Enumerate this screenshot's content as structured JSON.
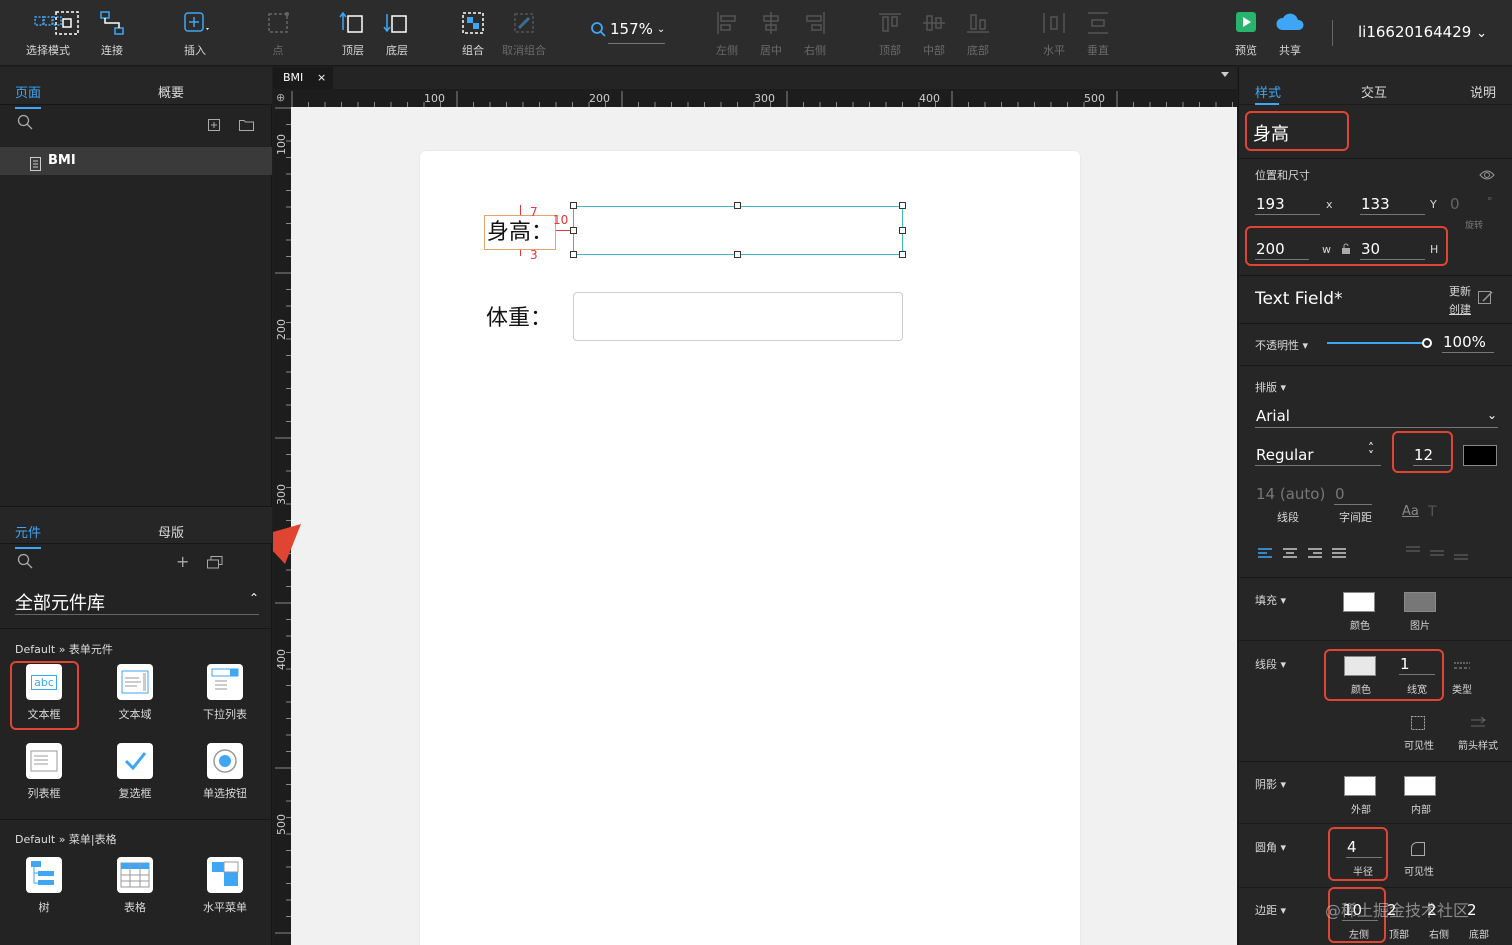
{
  "toolbar": {
    "select_mode": "选择模式",
    "connect": "连接",
    "insert": "插入",
    "point": "点",
    "top_layer": "顶层",
    "bottom_layer": "底层",
    "group": "组合",
    "ungroup": "取消组合",
    "zoom": "157%",
    "align_left": "左侧",
    "align_center": "居中",
    "align_right": "右侧",
    "align_top": "顶部",
    "align_middle": "中部",
    "align_bottom": "底部",
    "dist_h": "水平",
    "dist_v": "垂直",
    "preview": "预览",
    "share": "共享",
    "username": "li16620164429"
  },
  "pages_panel": {
    "tab_pages": "页面",
    "tab_outline": "概要",
    "page_item": "BMI"
  },
  "components_panel": {
    "tab_components": "元件",
    "tab_masters": "母版",
    "library": "全部元件库",
    "group1": "Default » 表单元件",
    "items1": [
      "文本框",
      "文本域",
      "下拉列表",
      "列表框",
      "复选框",
      "单选按钮"
    ],
    "group2": "Default » 菜单|表格",
    "items2": [
      "树",
      "表格",
      "水平菜单"
    ],
    "textbox_icon_text": "abc"
  },
  "canvas": {
    "doc_tab": "BMI",
    "hruler": [
      "100",
      "200",
      "300",
      "400",
      "500"
    ],
    "vruler": [
      "100",
      "200",
      "300",
      "400",
      "500"
    ],
    "label_height": "身高：",
    "label_weight": "体重：",
    "spacing_top": "7",
    "spacing_left": "10",
    "spacing_bottom": "3"
  },
  "inspector": {
    "tab_style": "样式",
    "tab_interact": "交互",
    "tab_notes": "说明",
    "element_name": "身高",
    "pos_size_label": "位置和尺寸",
    "x": "193",
    "x_lbl": "x",
    "y": "133",
    "y_lbl": "Y",
    "rotation": "0",
    "rotation_lbl": "旋转",
    "w": "200",
    "w_lbl": "w",
    "h": "30",
    "h_lbl": "H",
    "style_name": "Text Field*",
    "style_update": "更新",
    "style_create": "创建",
    "opacity_label": "不透明性",
    "opacity": "100%",
    "opacity_fraction": 1.0,
    "typography_label": "排版",
    "font": "Arial",
    "font_weight": "Regular",
    "font_size": "12",
    "line_height": "14 (auto)",
    "line_height_lbl": "线段",
    "letter_spacing": "0",
    "letter_spacing_lbl": "字间距",
    "fill_label": "填充",
    "fill_color": "颜色",
    "fill_image": "图片",
    "border_label": "线段",
    "border_color": "颜色",
    "border_width": "1",
    "border_width_lbl": "线宽",
    "border_type": "类型",
    "visibility": "可见性",
    "arrow_style": "箭头样式",
    "shadow_label": "阴影",
    "shadow_outer": "外部",
    "shadow_inner": "内部",
    "radius_label": "圆角",
    "radius": "4",
    "radius_lbl": "半径",
    "radius_vis": "可见性",
    "padding_label": "边距",
    "pad_left": "10",
    "pad_left_lbl": "左侧",
    "pad_top": "2",
    "pad_top_lbl": "顶部",
    "pad_right": "2",
    "pad_right_lbl": "右侧",
    "pad_bottom": "2",
    "pad_bottom_lbl": "底部",
    "watermark": "@稀土掘金技术社区"
  },
  "colors": {
    "accent": "#3ea6f5",
    "annotation": "#e04433",
    "selection": "#3fb7c4",
    "spacing": "#e0383b"
  }
}
